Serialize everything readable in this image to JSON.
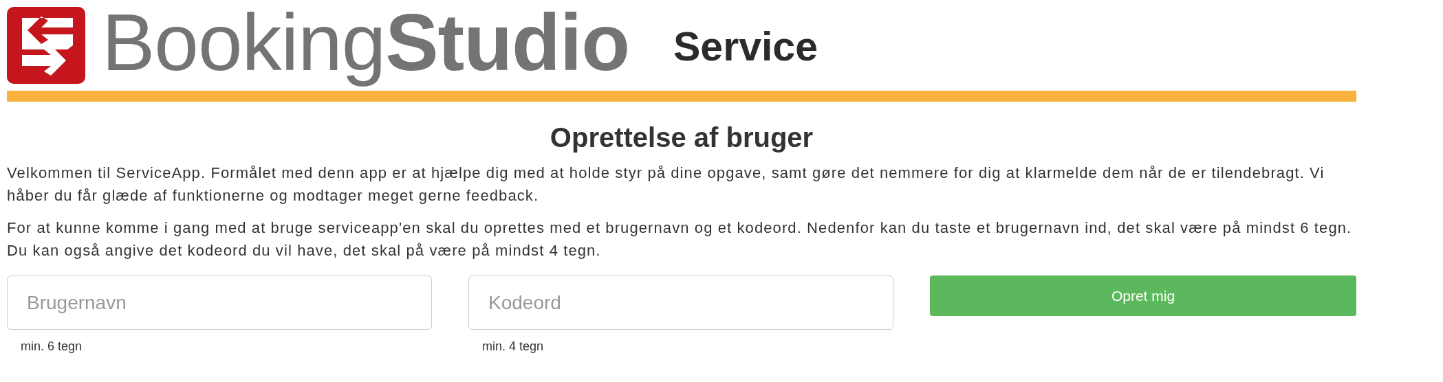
{
  "header": {
    "logo_text": "Booking**Studio**",
    "product": "Service"
  },
  "title": "Oprettelse af bruger",
  "paragraphs": [
    "Velkommen til ServiceApp. Formålet med denn app er at hjælpe dig med at holde styr på dine opgave, samt gøre det nemmere for dig at klarmelde dem når de er tilendebragt. Vi håber du får glæde af funktionerne og modtager meget gerne feedback.",
    "For at kunne komme i gang med at bruge serviceapp'en skal du oprettes med et brugernavn og et kodeord. Nedenfor kan du taste et brugernavn ind, det skal være på mindst 6 tegn. Du kan også angive det kodeord du vil have, det skal på være på mindst 4 tegn."
  ],
  "form": {
    "fields": [
      {
        "placeholder": "Brugernavn",
        "hint": "min. 6 tegn"
      },
      {
        "placeholder": "Kodeord",
        "hint": "min. 4 tegn"
      }
    ],
    "button": "Opret mig"
  }
}
